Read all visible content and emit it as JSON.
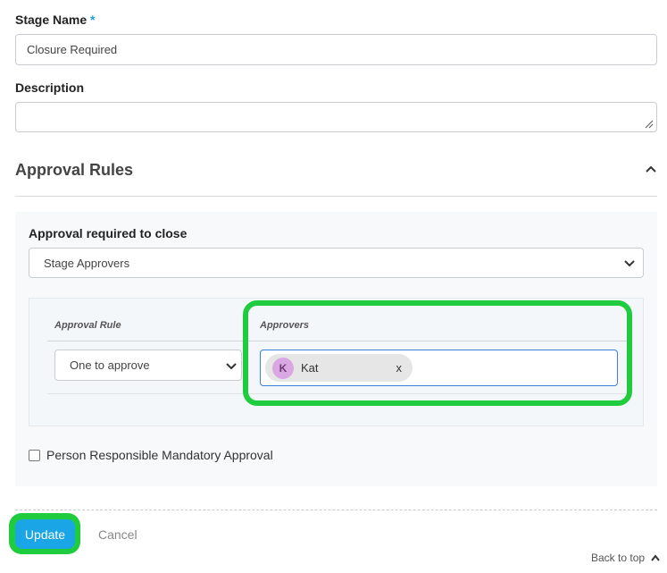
{
  "stage_name": {
    "label": "Stage Name",
    "required_marker": "*",
    "value": "Closure Required"
  },
  "description": {
    "label": "Description",
    "value": ""
  },
  "approval_rules": {
    "title": "Approval Rules",
    "collapse_icon": "chevron-up-icon",
    "approval_required_label": "Approval required to close",
    "approval_required_value": "Stage Approvers",
    "table": {
      "headers": [
        "Approval Rule",
        "Approvers"
      ],
      "rule_value": "One to approve",
      "approvers": [
        {
          "initial": "K",
          "name": "Kat",
          "remove": "x"
        }
      ]
    },
    "person_responsible_label": "Person Responsible Mandatory Approval",
    "person_responsible_checked": false
  },
  "actions": {
    "update_label": "Update",
    "cancel_label": "Cancel",
    "back_to_top_label": "Back to top"
  },
  "colors": {
    "accent": "#1aa6e6",
    "highlight": "#1fcc3e",
    "avatar": "#d9a8e3"
  }
}
